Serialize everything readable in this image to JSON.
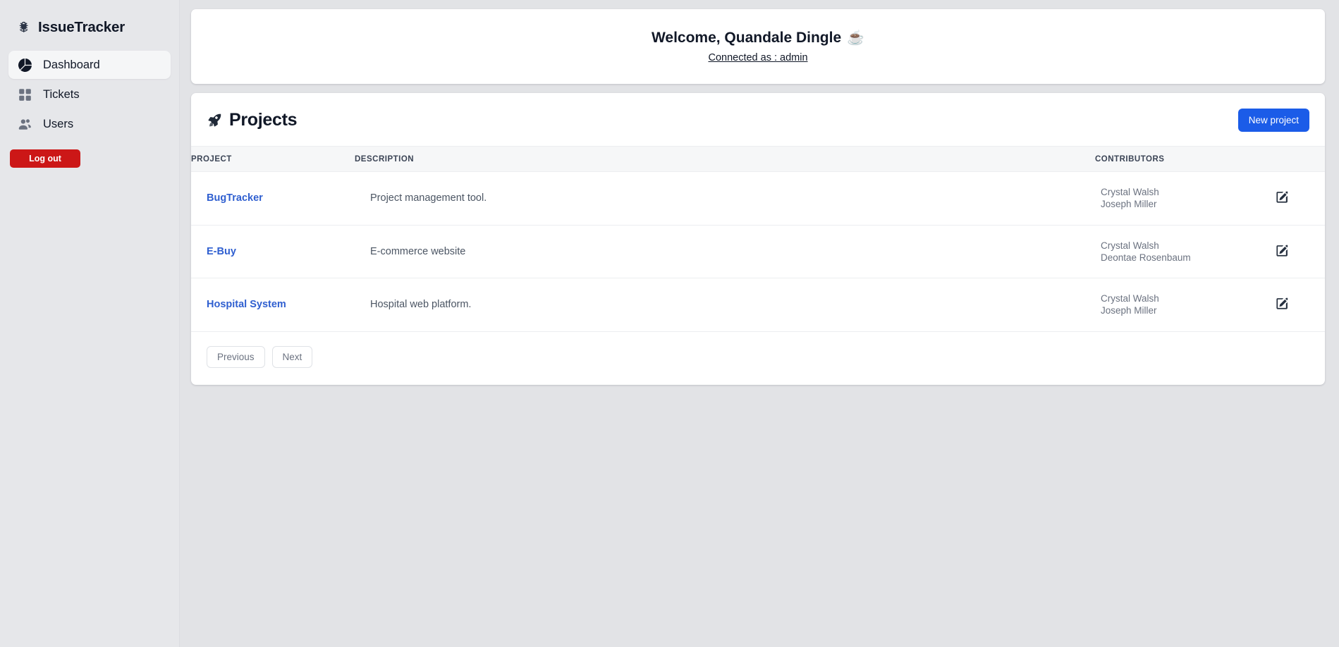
{
  "app": {
    "brand": "IssueTracker",
    "brand_icon": "bug-icon",
    "accent_color": "#1b5ce8",
    "danger_color": "#cc1717",
    "link_color": "#2f5fd0"
  },
  "sidebar": {
    "items": [
      {
        "label": "Dashboard",
        "icon": "pie-chart-icon",
        "active": true
      },
      {
        "label": "Tickets",
        "icon": "grid-icon",
        "active": false
      },
      {
        "label": "Users",
        "icon": "users-icon",
        "active": false
      }
    ],
    "logout_label": "Log out"
  },
  "header": {
    "welcome_text": "Welcome, Quandale Dingle",
    "welcome_emoji": "☕",
    "connected_as": "Connected as : admin"
  },
  "projects": {
    "title": "Projects",
    "title_icon": "rocket-icon",
    "new_project_label": "New project",
    "columns": {
      "project": "PROJECT",
      "description": "DESCRIPTION",
      "contributors": "CONTRIBUTORS",
      "actions": ""
    },
    "rows": [
      {
        "name": "BugTracker",
        "description": "Project management tool.",
        "contributors": [
          "Crystal Walsh",
          "Joseph Miller"
        ],
        "edit_icon": "pencil-square-icon"
      },
      {
        "name": "E-Buy",
        "description": "E-commerce website",
        "contributors": [
          "Crystal Walsh",
          "Deontae Rosenbaum"
        ],
        "edit_icon": "pencil-square-icon"
      },
      {
        "name": "Hospital System",
        "description": "Hospital web platform.",
        "contributors": [
          "Crystal Walsh",
          "Joseph Miller"
        ],
        "edit_icon": "pencil-square-icon"
      }
    ],
    "pagination": {
      "previous_label": "Previous",
      "next_label": "Next"
    }
  }
}
